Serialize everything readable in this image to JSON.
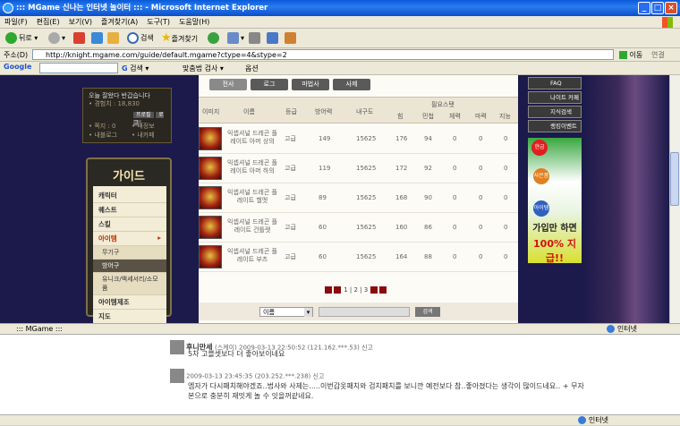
{
  "window": {
    "title": "::: MGame 신나는 인터넷 놀이터 ::: - Microsoft Internet Explorer"
  },
  "menu": [
    "파일(F)",
    "편집(E)",
    "보기(V)",
    "즐겨찾기(A)",
    "도구(T)",
    "도움말(H)"
  ],
  "toolbar": {
    "back": "뒤로",
    "search": "검색",
    "favorites": "즐겨찾기"
  },
  "address": {
    "label": "주소(D)",
    "url": "http://knight.mgame.com/guide/default.mgame?ctype=4&stype=2",
    "go": "이동",
    "links": "연결"
  },
  "google": {
    "label": "Google",
    "search": "검색",
    "spell": "맞춤법 검사",
    "options": "옵션"
  },
  "login": {
    "welcome": "오늘 잘왔다 반갑습니다",
    "exp": "• 경험치 : 18,830",
    "b1": "프로필",
    "b2": "로그",
    "l1": "• 쪽지 : 0",
    "l2": "• 내정보",
    "l3": "• 내블로그",
    "l4": "• 내카페"
  },
  "guide": {
    "title": "가이드",
    "items": [
      "캐릭터",
      "퀘스트",
      "스킬",
      "아이템",
      "무기구",
      "방어구",
      "유니크/액세서리/소모품",
      "아이템제조",
      "지도"
    ]
  },
  "tabs": [
    "전사",
    "로그",
    "마법사",
    "사제"
  ],
  "table": {
    "headers": {
      "image": "이미지",
      "name": "이름",
      "grade": "등급",
      "def": "방어력",
      "dur": "내구도",
      "req": "필요스탯",
      "str": "힘",
      "dex": "민첩",
      "con": "체력",
      "int": "마력",
      "wis": "지능"
    },
    "rows": [
      {
        "name": "익셉셔널 드레곤 플레이트 아머 상의",
        "grade": "고급",
        "def": "149",
        "dur": "15625",
        "str": "176",
        "dex": "94",
        "con": "0",
        "int": "0",
        "wis": "0"
      },
      {
        "name": "익셉셔널 드레곤 플레이트 아머 하의",
        "grade": "고급",
        "def": "119",
        "dur": "15625",
        "str": "172",
        "dex": "92",
        "con": "0",
        "int": "0",
        "wis": "0"
      },
      {
        "name": "익셉셔널 드레곤 플레이트 헬멧",
        "grade": "고급",
        "def": "89",
        "dur": "15625",
        "str": "168",
        "dex": "90",
        "con": "0",
        "int": "0",
        "wis": "0"
      },
      {
        "name": "익셉셔널 드레곤 플레이트 건틀렛",
        "grade": "고급",
        "def": "60",
        "dur": "15625",
        "str": "160",
        "dex": "86",
        "con": "0",
        "int": "0",
        "wis": "0"
      },
      {
        "name": "익셉셔널 드레곤 플레이트 부츠",
        "grade": "고급",
        "def": "60",
        "dur": "15625",
        "str": "164",
        "dex": "88",
        "con": "0",
        "int": "0",
        "wis": "0"
      }
    ]
  },
  "pager": "1 | 2 | 3",
  "search": {
    "select": "이름",
    "button": "검색"
  },
  "rightnav": [
    "FAQ",
    "나이트 카페",
    "지식검색",
    "랭킹이벤트"
  ],
  "ad": {
    "b1": "현금",
    "b2": "사은품",
    "b3": "아이템",
    "line1": "가입만 하면",
    "line2": "100% 지급!!"
  },
  "status1": {
    "text": "::: MGame :::",
    "zone": "인터넷"
  },
  "comments": [
    {
      "user": "후니만세",
      "meta": "(스케이) 2009-03-13 22:50:52 (121.162.***.53) 신고",
      "text": "5차 고블셋보다 더 좋아보이네요"
    },
    {
      "user": "",
      "meta": "2009-03-13 23:45:35 (203.252.***.238) 신고",
      "text": "엠자가 다시패치해야겠죠..법사와 사제는.....이번갑옷패치와 검치패치를 보니깐 예전보다 참..좋아졌다는 생각이 많이드네요.. + 무자",
      "text2": "본으로 충분히 재밋게 놀 수 잇을꺼같네요."
    }
  ],
  "status2": {
    "zone": "인터넷"
  }
}
